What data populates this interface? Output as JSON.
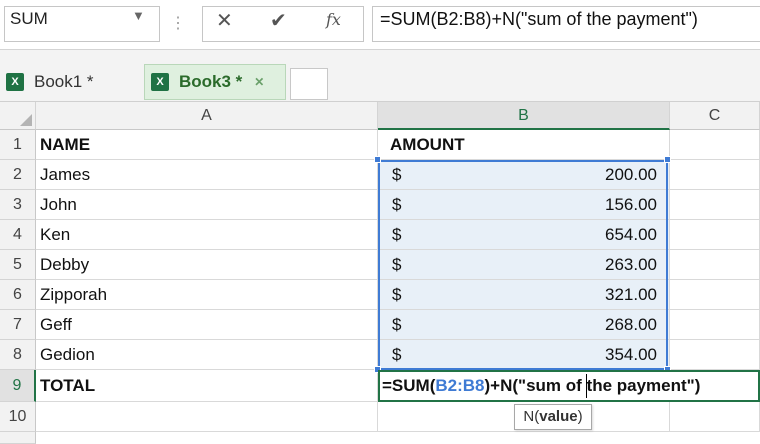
{
  "formula_bar": {
    "name_box": "SUM",
    "formula": "=SUM(B2:B8)+N(\"sum of the payment\")"
  },
  "tabs": [
    {
      "label": "Book1 *",
      "active": false,
      "icon": "excel-file-icon"
    },
    {
      "label": "Book3 *",
      "active": true,
      "icon": "excel-file-icon"
    }
  ],
  "columns": [
    "A",
    "B",
    "C"
  ],
  "rows": [
    {
      "num": "1",
      "a": "NAME",
      "b_currency": "",
      "b_value": "AMOUNT",
      "header": true
    },
    {
      "num": "2",
      "a": "James",
      "b_currency": "$",
      "b_value": "200.00"
    },
    {
      "num": "3",
      "a": "John",
      "b_currency": "$",
      "b_value": "156.00"
    },
    {
      "num": "4",
      "a": "Ken",
      "b_currency": "$",
      "b_value": "654.00"
    },
    {
      "num": "5",
      "a": "Debby",
      "b_currency": "$",
      "b_value": "263.00"
    },
    {
      "num": "6",
      "a": "Zipporah",
      "b_currency": "$",
      "b_value": "321.00"
    },
    {
      "num": "7",
      "a": "Geff",
      "b_currency": "$",
      "b_value": "268.00"
    },
    {
      "num": "8",
      "a": "Gedion",
      "b_currency": "$",
      "b_value": "354.00"
    },
    {
      "num": "9",
      "a": "TOTAL",
      "b_currency": "",
      "b_value": ""
    },
    {
      "num": "10",
      "a": "",
      "b_currency": "",
      "b_value": ""
    }
  ],
  "edit_cell": {
    "part1": "=SUM(",
    "ref": "B2:B8",
    "part2": ")+N(\"sum",
    "part3": " of the payment\")"
  },
  "tooltip": {
    "fn": "N(",
    "arg": "value",
    "close": ")"
  },
  "colors": {
    "accent": "#217346",
    "range": "#3f7bd4"
  }
}
